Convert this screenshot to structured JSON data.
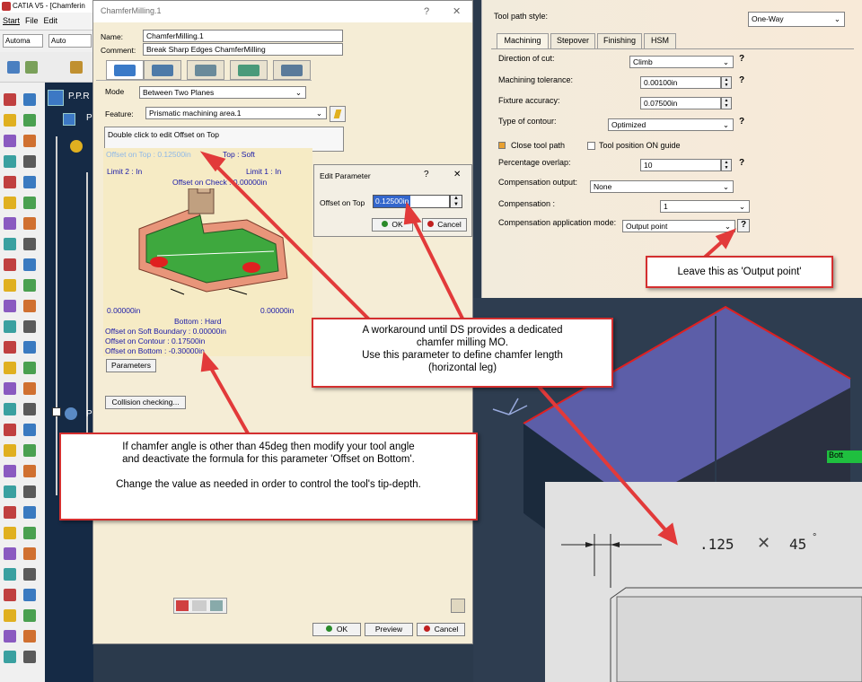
{
  "app": {
    "title": "CATIA V5 - [Chamferin",
    "menu": [
      "Start",
      "File",
      "Edit"
    ],
    "combo1": "Automa",
    "combo2": "Auto"
  },
  "tree": {
    "node1": "P.P.R",
    "node2": "P",
    "node3": "P"
  },
  "main_dialog": {
    "title": "ChamferMilling.1",
    "help": "?",
    "close": "✕",
    "name_label": "Name:",
    "name_value": "ChamferMilling.1",
    "comment_label": "Comment:",
    "comment_value": "Break Sharp Edges ChamferMilling",
    "mode_label": "Mode",
    "mode_value": "Between Two Planes",
    "feature_label": "Feature:",
    "feature_value": "Prismatic machining area.1",
    "hint": "Double click to edit Offset on Top",
    "fig": {
      "offset_top": "Offset on Top : 0.12500in",
      "top": "Top : Soft",
      "limit2": "Limit 2 : In",
      "limit1": "Limit 1 : In",
      "offset_check": "Offset on Check : 0.00000in",
      "dim_left": "0.00000in",
      "dim_right": "0.00000in",
      "bottom": "Bottom : Hard",
      "soft_boundary": "Offset on Soft Boundary : 0.00000in",
      "contour": "Offset on Contour : 0.17500in",
      "bottom_offset": "Offset on Bottom : -0.30000in"
    },
    "parameters_btn": "Parameters",
    "collision_btn": "Collision checking...",
    "ok": "OK",
    "preview": "Preview",
    "cancel": "Cancel"
  },
  "edit_param": {
    "title": "Edit Parameter",
    "help": "?",
    "close": "✕",
    "label": "Offset on Top",
    "value": "0.12500in",
    "ok": "OK",
    "cancel": "Cancel"
  },
  "toolpath": {
    "style_label": "Tool path style:",
    "style_value": "One-Way",
    "tabs": [
      "Machining",
      "Stepover",
      "Finishing",
      "HSM"
    ],
    "rows": {
      "direction_label": "Direction of cut:",
      "direction_value": "Climb",
      "tolerance_label": "Machining tolerance:",
      "tolerance_value": "0.00100in",
      "fixture_label": "Fixture accuracy:",
      "fixture_value": "0.07500in",
      "contour_label": "Type of contour:",
      "contour_value": "Optimized",
      "close_label": "Close tool path",
      "guide_label": "Tool position ON guide",
      "overlap_label": "Percentage overlap:",
      "overlap_value": "10",
      "compout_label": "Compensation output:",
      "compout_value": "None",
      "comp_label": "Compensation  :",
      "comp_value": "1",
      "compmode_label": "Compensation application mode:",
      "compmode_value": "Output point"
    },
    "q": "?"
  },
  "callouts": {
    "output_point": "Leave this as 'Output point'",
    "workaround": [
      "A workaround until DS provides a dedicated",
      "chamfer milling MO.",
      "Use this parameter to define chamfer length",
      "(horizontal leg)"
    ],
    "angle": [
      "If chamfer angle is other than 45deg then modify your tool angle",
      "and deactivate the formula for this parameter 'Offset on Bottom'.",
      "",
      "Change the value as needed in order to control the tool's tip-depth."
    ]
  },
  "viewport": {
    "tag": "Bott"
  },
  "detail": {
    "dim": ".125",
    "x": "✕",
    "angle": "45",
    "deg": "°"
  },
  "colors": {
    "callout_border": "#d42f2f",
    "dialog_bg": "#f5edd6",
    "selection": "#3366cc"
  }
}
